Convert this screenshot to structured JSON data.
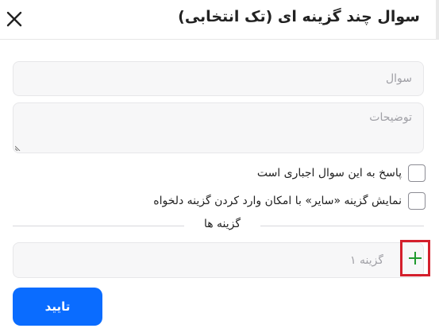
{
  "dialog": {
    "title": "سوال چند گزینه ای (تک انتخابی)",
    "close_icon": "close-icon"
  },
  "form": {
    "question_placeholder": "سوال",
    "question_value": "",
    "description_placeholder": "توضیحات",
    "description_value": "",
    "required_label": "پاسخ به این سوال اجباری است",
    "required_checked": false,
    "other_label": "نمایش گزینه «سایر» با امکان وارد کردن گزینه دلخواه",
    "other_checked": false
  },
  "options": {
    "section_label": "گزینه ها",
    "items": [
      {
        "placeholder": "گزینه ۱",
        "value": ""
      }
    ],
    "add_icon": "plus-icon",
    "add_icon_color": "#1f9a2e",
    "highlight_color": "#d41f2c"
  },
  "footer": {
    "confirm_label": "تایید",
    "confirm_color": "#0a6cff"
  }
}
